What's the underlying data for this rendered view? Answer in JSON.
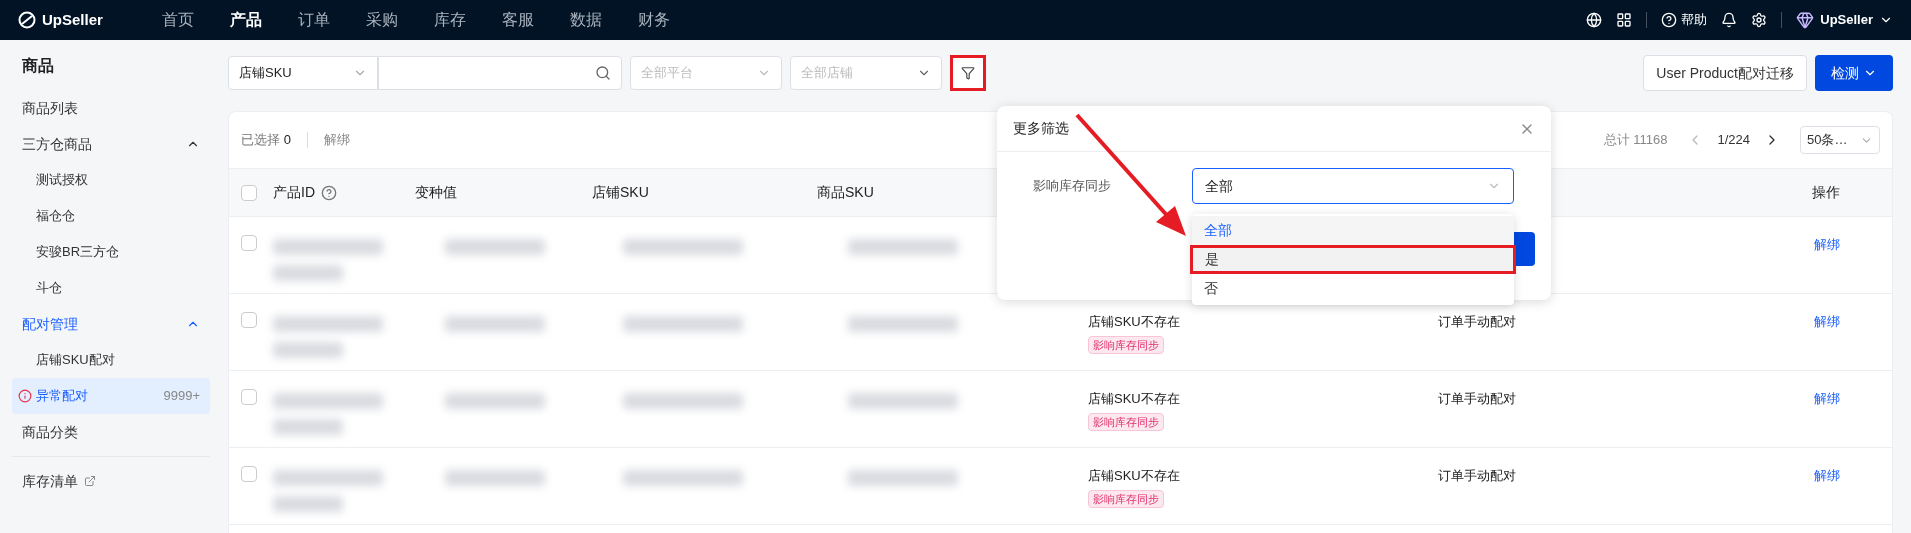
{
  "top_nav": {
    "logo": "UpSeller",
    "items": [
      {
        "label": "首页",
        "selected": false
      },
      {
        "label": "产品",
        "selected": true
      },
      {
        "label": "订单",
        "selected": false
      },
      {
        "label": "采购",
        "selected": false
      },
      {
        "label": "库存",
        "selected": false
      },
      {
        "label": "客服",
        "selected": false
      },
      {
        "label": "数据",
        "selected": false
      },
      {
        "label": "财务",
        "selected": false
      }
    ],
    "help": "帮助",
    "account": "UpSeller"
  },
  "sidebar": {
    "title": "商品",
    "items": [
      {
        "label": "商品列表",
        "kind": "item",
        "selected": false
      },
      {
        "label": "三方仓商品",
        "kind": "group",
        "expanded": true,
        "selected": false,
        "children": [
          {
            "label": "测试授权",
            "selected": false
          },
          {
            "label": "福仓仓",
            "selected": false
          },
          {
            "label": "安骏BR三方仓",
            "selected": false
          },
          {
            "label": "斗仓",
            "selected": false
          }
        ]
      },
      {
        "label": "配对管理",
        "kind": "group",
        "expanded": true,
        "selected": true,
        "children": [
          {
            "label": "店铺SKU配对",
            "selected": false
          },
          {
            "label": "异常配对",
            "selected": true,
            "badge": "9999+"
          }
        ]
      },
      {
        "label": "商品分类",
        "kind": "item",
        "selected": false
      },
      {
        "label": "库存清单",
        "kind": "external",
        "selected": false
      }
    ]
  },
  "toolbar": {
    "search_type": "店铺SKU",
    "platform_placeholder": "全部平台",
    "store_placeholder": "全部店铺",
    "migrate_button": "User Product配对迁移",
    "detect_button": "检测"
  },
  "table": {
    "selected_label": "已选择",
    "selected_count": "0",
    "bulk_action": "解绑",
    "total": "总计 11168",
    "page": "1/224",
    "page_size": "50条…",
    "columns": [
      "产品ID",
      "变种值",
      "店铺SKU",
      "商品SKU",
      "操作"
    ],
    "all_checked": false,
    "rows": [
      {
        "action": "解绑",
        "checked": false
      },
      {
        "checked": false,
        "status": "店铺SKU不存在",
        "tag": "影响库存同步",
        "match": "订单手动配对",
        "action": "解绑"
      },
      {
        "checked": false,
        "status": "店铺SKU不存在",
        "tag": "影响库存同步",
        "match": "订单手动配对",
        "action": "解绑"
      },
      {
        "checked": false,
        "status": "店铺SKU不存在",
        "tag": "影响库存同步",
        "match": "订单手动配对",
        "action": "解绑"
      }
    ]
  },
  "filter_popup": {
    "title": "更多筛选",
    "field_label": "影响库存同步",
    "value": "全部",
    "options": [
      {
        "label": "全部",
        "selected": true,
        "highlighted": false
      },
      {
        "label": "是",
        "selected": false,
        "highlighted": true
      },
      {
        "label": "否",
        "selected": false,
        "highlighted": false
      }
    ]
  }
}
